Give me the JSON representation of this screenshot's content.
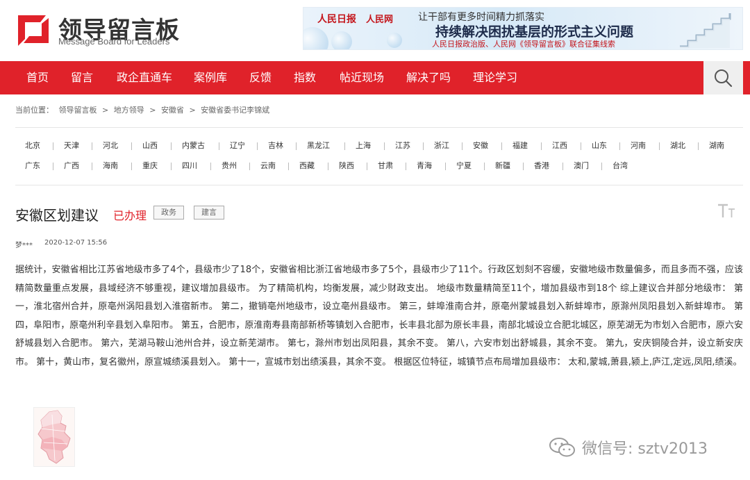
{
  "brand": {
    "name_cn": "领导留言板",
    "name_en": "Message Board for Leaders",
    "accent": "#e0222a"
  },
  "banner": {
    "logo_people_daily": "人民日报",
    "logo_people_net": "人民网",
    "line1": "让干部有更多时间精力抓落实",
    "line2": "持续解决困扰基层的形式主义问题",
    "line3": "人民日报政治版、人民网《领导留言板》联合征集线索"
  },
  "nav": {
    "items": [
      "首页",
      "留言",
      "政企直通车",
      "案例库",
      "反馈",
      "指数",
      "帖近现场",
      "解决了吗",
      "理论学习"
    ],
    "search_icon": "search-icon"
  },
  "breadcrumb": {
    "items": [
      "当前位置：",
      "领导留言板",
      ">",
      "地方领导",
      ">",
      "安徽省",
      ">",
      "安徽省委书记李锦斌"
    ]
  },
  "provinces": {
    "row1": [
      "北京",
      "天津",
      "河北",
      "山西",
      "内蒙古",
      "辽宁",
      "吉林",
      "黑龙江",
      "上海",
      "江苏",
      "浙江",
      "安徽",
      "福建",
      "江西",
      "山东",
      "河南",
      "湖北",
      "湖南"
    ],
    "row2": [
      "广东",
      "广西",
      "海南",
      "重庆",
      "四川",
      "贵州",
      "云南",
      "西藏",
      "陕西",
      "甘肃",
      "青海",
      "宁夏",
      "新疆",
      "香港",
      "澳门",
      "台湾"
    ]
  },
  "message": {
    "title": "安徽区划建议",
    "status": "已办理",
    "tags": [
      "政务",
      "建言"
    ],
    "user": "梦***",
    "time": "2020-12-07 15:56",
    "body": "据统计，安徽省相比江苏省地级市多了4个，县级市少了18个，安徽省相比浙江省地级市多了5个，县级市少了11个。行政区划刻不容缓，安徽地级市数量偏多，而且多而不强，应该精简数量重点发展，县域经济不够重视，建议增加县级市。 为了精简机构，均衡发展，减少财政支出。 地级市数量精简至11个，增加县级市到18个 综上建议合并部分地级市： 第一，淮北宿州合并，原亳州涡阳县划入淮宿新市。 第二，撤销亳州地级市，设立亳州县级市。 第三，蚌埠淮南合并，原亳州蒙城县划入新蚌埠市，原滁州凤阳县划入新蚌埠市。 第四，阜阳市，原亳州利辛县划入阜阳市。 第五，合肥市，原淮南寿县南部新桥等镇划入合肥市，长丰县北部为原长丰县，南部北城设立合肥北城区，原芜湖无为市划入合肥市，原六安舒城县划入合肥市。 第六，芜湖马鞍山池州合并，设立新芜湖市。 第七，滁州市划出凤阳县，其余不变。 第八，六安市划出舒城县，其余不变。 第九，安庆铜陵合并，设立新安庆市。 第十，黄山市，复名徽州，原宣城绩溪县划入。 第十一，宣城市划出绩溪县，其余不变。 根据区位特征，城镇节点布局增加县级市： 太和,蒙城,萧县,颍上,庐江,定远,凤阳,绩溪。"
  },
  "watermark": {
    "text": "微信号: sztv2013",
    "icon": "wechat-icon"
  }
}
